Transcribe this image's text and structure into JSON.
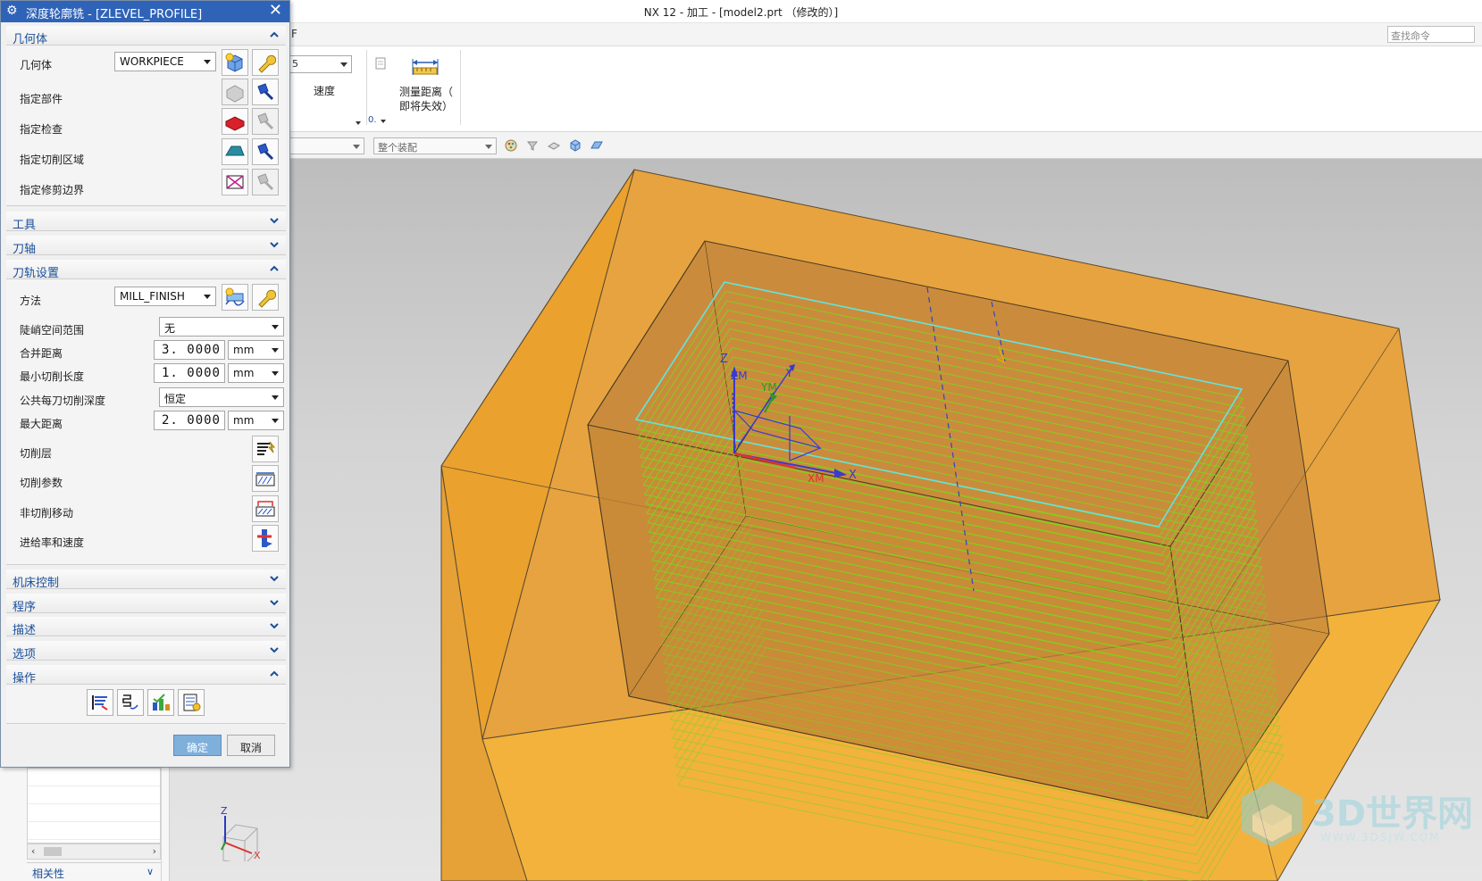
{
  "window": {
    "title": "NX 12 - 加工 - [model2.prt （修改的）]"
  },
  "ribbon": {
    "find_command": "查找命令",
    "tab_fragment": "F",
    "combo_fragment": "5",
    "speed_label": "速度",
    "measure_label_line1": "测量距离（",
    "measure_label_line2": "即将失效）",
    "small_fragment": "0."
  },
  "filterbar": {
    "combo1": "",
    "combo2": "整个装配"
  },
  "dialog": {
    "title": "深度轮廓铣 - [ZLEVEL_PROFILE]",
    "sections": {
      "geometry": "几何体",
      "tool": "工具",
      "axis": "刀轴",
      "path_settings": "刀轨设置",
      "machine_control": "机床控制",
      "program": "程序",
      "description": "描述",
      "options": "选项",
      "actions": "操作"
    },
    "geometry": {
      "geometry_label": "几何体",
      "geometry_value": "WORKPIECE",
      "part_label": "指定部件",
      "check_label": "指定检查",
      "cut_area_label": "指定切削区域",
      "trim_label": "指定修剪边界"
    },
    "path": {
      "method_label": "方法",
      "method_value": "MILL_FINISH",
      "steep_label": "陡峭空间范围",
      "steep_value": "无",
      "merge_label": "合并距离",
      "merge_value": "3. 0000",
      "merge_unit": "mm",
      "min_len_label": "最小切削长度",
      "min_len_value": "1. 0000",
      "min_len_unit": "mm",
      "depth_label": "公共每刀切削深度",
      "depth_value": "恒定",
      "max_dist_label": "最大距离",
      "max_dist_value": "2. 0000",
      "max_dist_unit": "mm",
      "cut_levels_label": "切削层",
      "cut_params_label": "切削参数",
      "noncut_label": "非切削移动",
      "feeds_label": "进给率和速度"
    },
    "buttons": {
      "ok": "确定",
      "cancel": "取消"
    }
  },
  "navigator": {
    "relevance": "相关性"
  },
  "viewport": {
    "csys_labels": {
      "z": "Z",
      "zm": "ZM",
      "ym": "YM",
      "y": "Y",
      "xm": "XM",
      "x": "X"
    },
    "triad_labels": {
      "z": "Z",
      "x": "X"
    }
  },
  "watermark": {
    "brand": "3D世界网",
    "url": "WWW.3DSJW.COM"
  },
  "colors": {
    "dialog_title": "#2f63b8",
    "section_label": "#1a4f9a",
    "stock_orange": "#f2a21c",
    "toolpath_green": "#7ad61e",
    "toolpath_top_cyan": "#5ee6e0"
  }
}
